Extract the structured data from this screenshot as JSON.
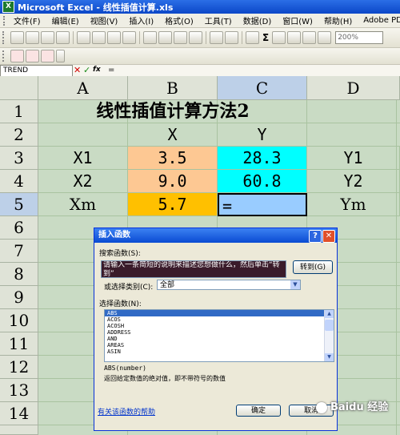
{
  "window": {
    "title": "Microsoft Excel - 线性插值计算.xls"
  },
  "menu": [
    "文件(F)",
    "编辑(E)",
    "视图(V)",
    "插入(I)",
    "格式(O)",
    "工具(T)",
    "数据(D)",
    "窗口(W)",
    "帮助(H)",
    "Adobe PDF(B)"
  ],
  "toolbar": {
    "zoom": "200%",
    "sum_symbol": "Σ"
  },
  "formula_bar": {
    "name_box": "TREND",
    "cancel_symbol": "✕",
    "enter_symbol": "✓",
    "fx_symbol": "fx",
    "value": "="
  },
  "columns": [
    "A",
    "B",
    "C",
    "D"
  ],
  "rows": [
    "1",
    "2",
    "3",
    "4",
    "5",
    "6",
    "7",
    "8",
    "9",
    "10",
    "11",
    "12",
    "13",
    "14"
  ],
  "sheet": {
    "title": "线性插值计算方法2",
    "x_header": "X",
    "y_header": "Y",
    "x1_label": "X1",
    "x1_value": "3.5",
    "y1_value": "28.3",
    "y1_label": "Y1",
    "x2_label": "X2",
    "x2_value": "9.0",
    "y2_value": "60.8",
    "y2_label": "Y2",
    "xm_label": "Xm",
    "xm_value": "5.7",
    "ym_formula": "=",
    "ym_label": "Ym"
  },
  "colors": {
    "x_fill": "#fdc893",
    "y_fill": "#00ffff",
    "xm_fill": "#ffc000",
    "ym_fill": "#99ccff",
    "sheet_bg": "#c9dbc4"
  },
  "dialog": {
    "title": "插入函数",
    "help_symbol": "?",
    "close_symbol": "✕",
    "search_label": "搜索函数(S):",
    "search_text": "请输入一条简短的说明来描述您想做什么，然后单击“转到”",
    "go_button": "转到(G)",
    "category_label": "或选择类别(C):",
    "category_value": "全部",
    "function_label": "选择函数(N):",
    "functions": [
      "ABS",
      "ACOS",
      "ACOSH",
      "ADDRESS",
      "AND",
      "AREAS",
      "ASIN"
    ],
    "signature": "ABS(number)",
    "description": "返回给定数值的绝对值，即不带符号的数值",
    "help_link": "有关该函数的帮助",
    "ok_button": "确定",
    "cancel_button": "取消"
  },
  "watermark": {
    "text": "Baidu 经验"
  }
}
